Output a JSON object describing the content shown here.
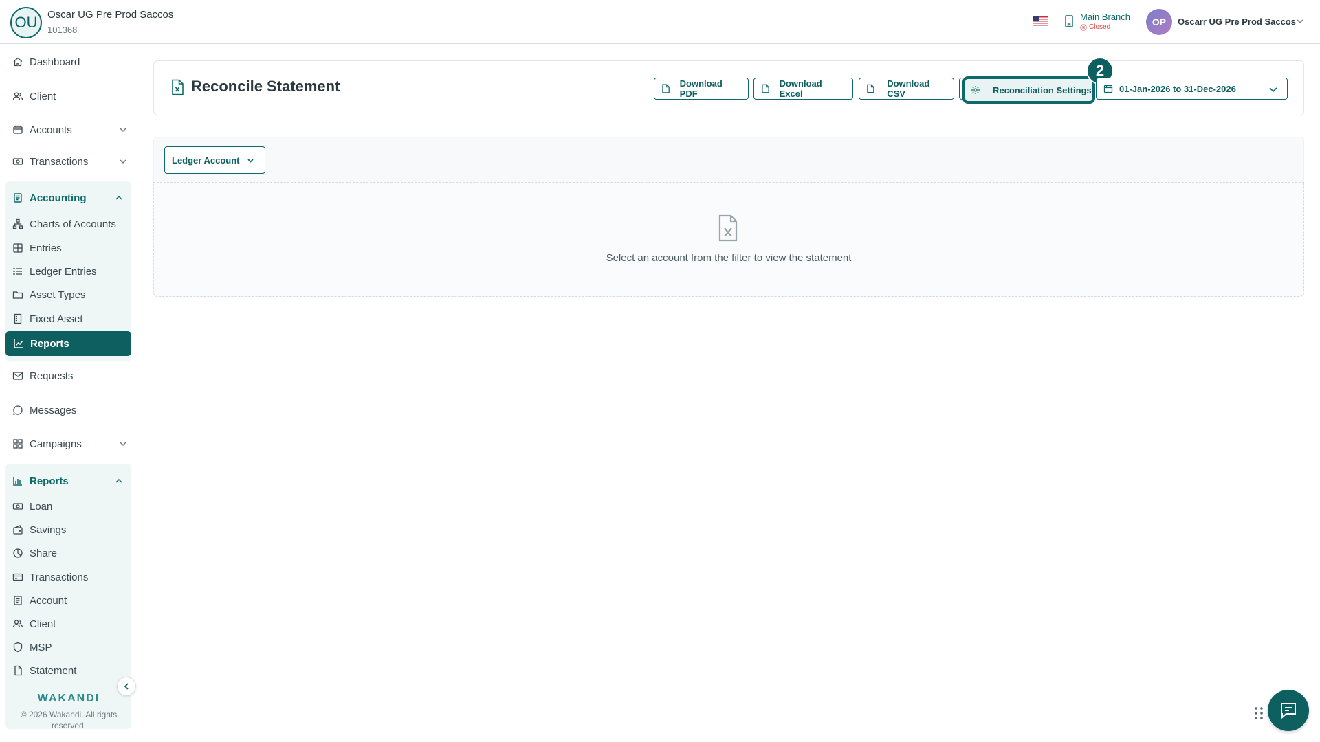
{
  "header": {
    "org_initials": "OU",
    "org_name": "Oscar UG Pre Prod Saccos",
    "org_id": "101368",
    "branch_name": "Main Branch",
    "branch_status": "Closed",
    "user_initials": "OP",
    "user_name": "Oscarr UG Pre Prod Saccos"
  },
  "sidebar": {
    "items": {
      "dashboard": "Dashboard",
      "client": "Client",
      "accounts": "Accounts",
      "transactions": "Transactions",
      "requests": "Requests",
      "messages": "Messages",
      "campaigns": "Campaigns"
    },
    "accounting": {
      "label": "Accounting",
      "items": [
        "Charts of Accounts",
        "Entries",
        "Ledger Entries",
        "Asset Types",
        "Fixed Asset"
      ],
      "active": "Reports"
    },
    "reports": {
      "label": "Reports",
      "items": [
        "Loan",
        "Savings",
        "Share",
        "Transactions",
        "Account",
        "Client",
        "MSP",
        "Statement"
      ]
    },
    "brand": "WAKANDI",
    "copyright": "© 2026 Wakandi. All rights reserved."
  },
  "main": {
    "title": "Reconcile Statement",
    "buttons": {
      "pdf": "Download PDF",
      "excel": "Download Excel",
      "csv": "Download CSV",
      "recon": "Reconciliation Settings"
    },
    "step_badge": "2",
    "date_range": "01-Jan-2026 to 31-Dec-2026",
    "filter": "Ledger Account",
    "empty_message": "Select an account from the filter to view the statement"
  },
  "colors": {
    "primary": "#0e5f5f",
    "active_bg": "#eef6f6",
    "danger": "#e04848"
  }
}
